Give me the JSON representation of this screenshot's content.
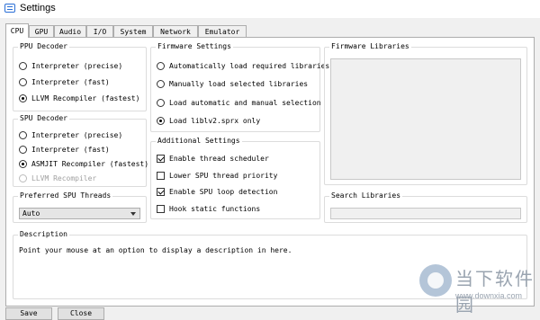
{
  "window": {
    "title": "Settings"
  },
  "tabs": [
    {
      "label": "CPU",
      "active": true
    },
    {
      "label": "GPU"
    },
    {
      "label": "Audio"
    },
    {
      "label": "I/O"
    },
    {
      "label": "System"
    },
    {
      "label": "Network"
    },
    {
      "label": "Emulator"
    }
  ],
  "ppu": {
    "title": "PPU Decoder",
    "options": [
      "Interpreter (precise)",
      "Interpreter (fast)",
      "LLVM Recompiler (fastest)"
    ],
    "selected": 2
  },
  "spu": {
    "title": "SPU Decoder",
    "options": [
      "Interpreter (precise)",
      "Interpreter (fast)",
      "ASMJIT Recompiler (fastest)",
      "LLVM Recompiler"
    ],
    "selected": 2,
    "disabled": [
      3
    ]
  },
  "spu_threads": {
    "title": "Preferred SPU Threads",
    "value": "Auto"
  },
  "firmware": {
    "title": "Firmware Settings",
    "options": [
      "Automatically load required libraries",
      "Manually load selected libraries",
      "Load automatic and manual selection",
      "Load liblv2.sprx only"
    ],
    "selected": 3
  },
  "additional": {
    "title": "Additional Settings",
    "options": [
      {
        "label": "Enable thread scheduler",
        "checked": true
      },
      {
        "label": "Lower SPU thread priority",
        "checked": false
      },
      {
        "label": "Enable SPU loop detection",
        "checked": true
      },
      {
        "label": "Hook static functions",
        "checked": false
      }
    ]
  },
  "libraries": {
    "title": "Firmware Libraries"
  },
  "search": {
    "title": "Search Libraries",
    "placeholder": ""
  },
  "description": {
    "title": "Description",
    "text": "Point your mouse at an option to display a description in here."
  },
  "buttons": {
    "save": "Save",
    "close": "Close"
  },
  "watermark": {
    "text": "当下软件园",
    "url": "www.downxia.com"
  }
}
